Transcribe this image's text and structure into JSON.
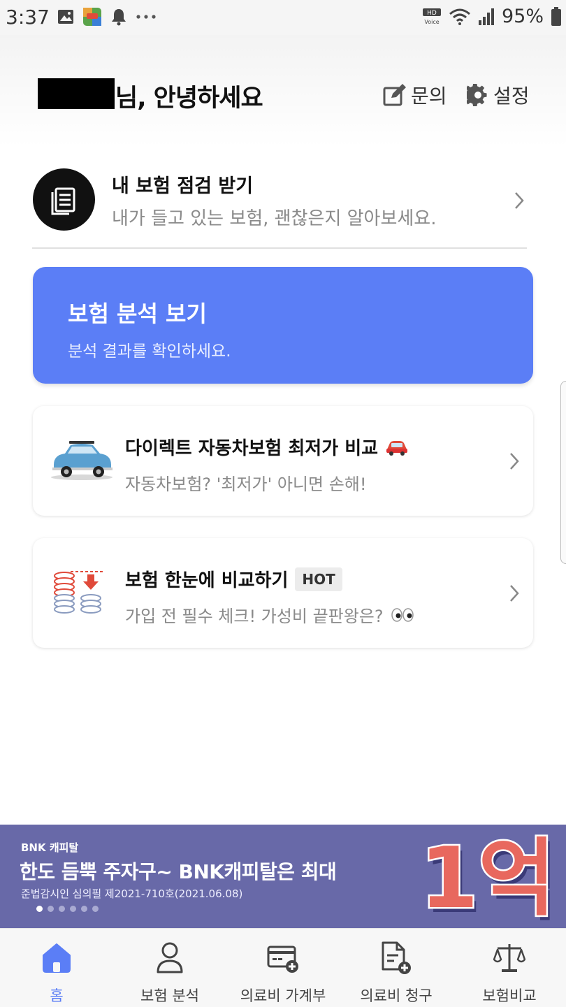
{
  "status_bar": {
    "time": "3:37",
    "battery": "95%",
    "voice_label_top": "HD",
    "voice_label_bottom": "Voice"
  },
  "header": {
    "greeting": "님, 안녕하세요",
    "inquiry_label": "문의",
    "settings_label": "설정"
  },
  "insurance_check": {
    "title": "내 보험 점검 받기",
    "subtitle": "내가 들고 있는 보험, 괜찮은지 알아보세요."
  },
  "analysis_card": {
    "title": "보험 분석 보기",
    "subtitle": "분석 결과를 확인하세요."
  },
  "cards": [
    {
      "title": "다이렉트 자동차보험 최저가 비교",
      "subtitle": "자동차보험? '최저가' 아니면 손해!"
    },
    {
      "title": "보험 한눈에 비교하기",
      "badge": "HOT",
      "subtitle": "가입 전 필수 체크! 가성비 끝판왕은?"
    }
  ],
  "banner": {
    "brand": "BNK 캐피탈",
    "title": "한도 듬뿍 주자구~ BNK캐피탈은 최대",
    "note": "준법감시인 심의필 제2021-710호(2021.06.08)",
    "graphic_text": "1억",
    "slide_count": 6,
    "active_slide": 1
  },
  "bottom_nav": [
    {
      "label": "홈",
      "active": true
    },
    {
      "label": "보험 분석",
      "active": false
    },
    {
      "label": "의료비 가계부",
      "active": false
    },
    {
      "label": "의료비 청구",
      "active": false
    },
    {
      "label": "보험비교",
      "active": false
    }
  ],
  "colors": {
    "accent": "#5b7ef6",
    "banner_bg": "#6869a8",
    "banner_graphic": "#e8685e"
  }
}
